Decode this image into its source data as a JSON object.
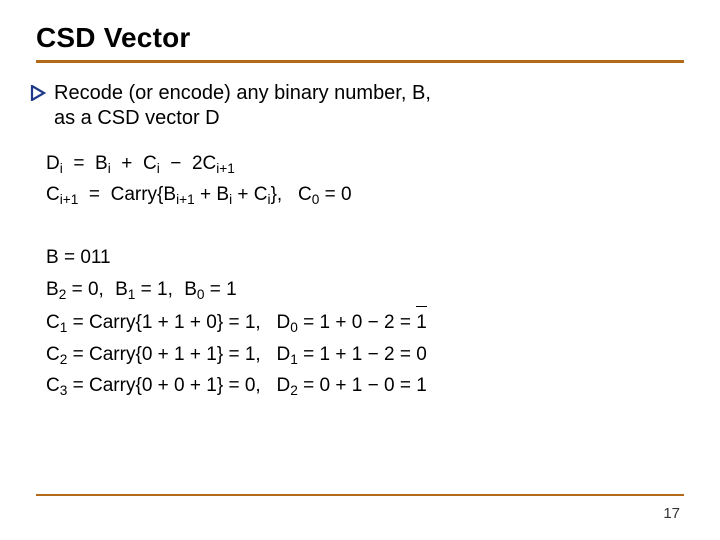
{
  "title": "CSD Vector",
  "bullet": {
    "line1": "Recode (or encode) any binary number, B,",
    "line2": "as a CSD vector D"
  },
  "eq": {
    "d_def_lhs": "D",
    "d_def_rhs_a": "B",
    "d_def_rhs_b": "C",
    "d_def_rhs_c": "2C",
    "c_def_lhs": "C",
    "carry_label": "Carry",
    "carry_args_a": "B",
    "carry_args_b": "B",
    "carry_args_c": "C",
    "c0_lhs": "C",
    "c0_rhs": "0",
    "b_eq": "B = 011",
    "b2": "B",
    "b2v": "0",
    "b1": "B",
    "b1v": "1",
    "b0": "B",
    "b0v": "1",
    "c1_lhs": "C",
    "c1_carry": "1 + 1 + 0",
    "c1_val": "1",
    "d0_lhs": "D",
    "d0_expr": "1 + 0 − 2",
    "d0_val": "1",
    "c2_lhs": "C",
    "c2_carry": "0 + 1 + 1",
    "c2_val": "1",
    "d1_lhs": "D",
    "d1_expr": "1 + 1 − 2",
    "d1_val": "0",
    "c3_lhs": "C",
    "c3_carry": "0 + 0 + 1",
    "c3_val": "0",
    "d2_lhs": "D",
    "d2_expr": "0 + 1 − 0",
    "d2_val": "1"
  },
  "page": "17",
  "colors": {
    "accent": "#b36b1a"
  }
}
